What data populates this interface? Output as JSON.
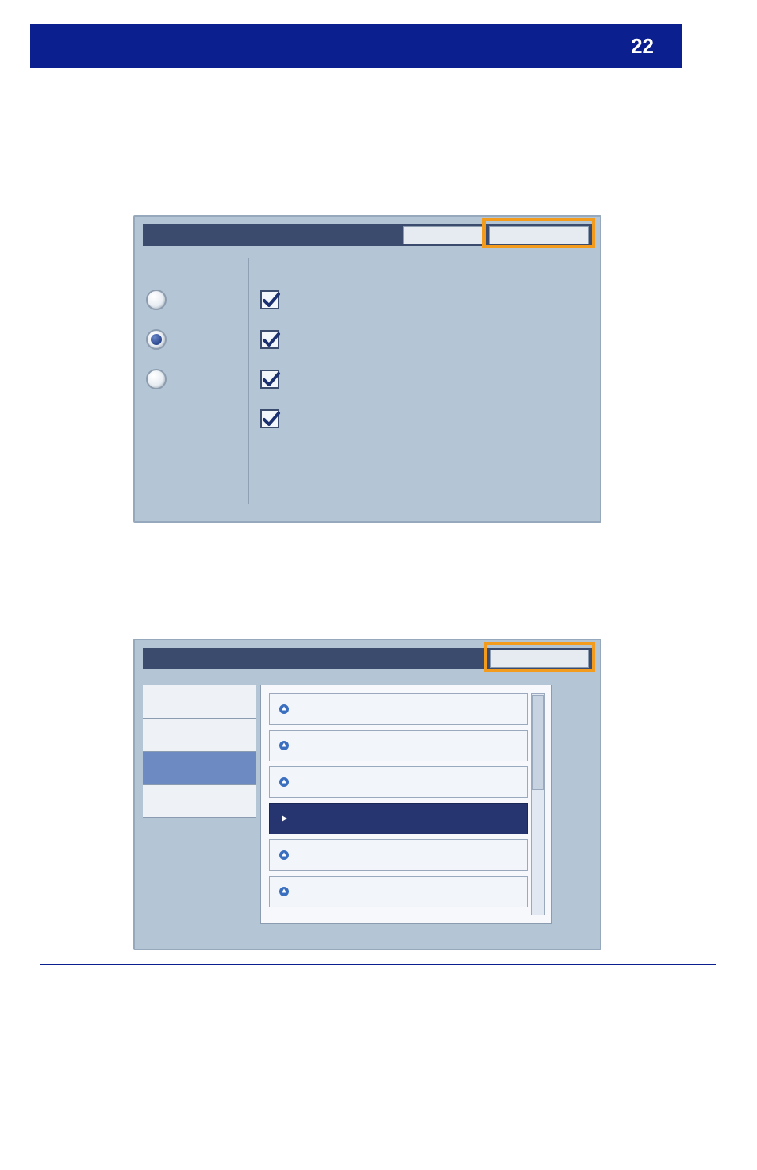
{
  "header": {
    "page_number": "22"
  },
  "panel_a": {
    "radio_items": [
      {
        "checked": false
      },
      {
        "checked": true
      },
      {
        "checked": false
      }
    ],
    "check_items": [
      {
        "checked": true
      },
      {
        "checked": true
      },
      {
        "checked": true
      },
      {
        "checked": true
      }
    ]
  },
  "panel_b": {
    "sidebar_items": [
      {
        "selected": false
      },
      {
        "selected": false
      },
      {
        "selected": true
      },
      {
        "selected": false
      }
    ],
    "list_items": [
      {
        "type": "up",
        "active": false
      },
      {
        "type": "up",
        "active": false
      },
      {
        "type": "up",
        "active": false
      },
      {
        "type": "play",
        "active": true
      },
      {
        "type": "up",
        "active": false
      },
      {
        "type": "up",
        "active": false
      }
    ]
  }
}
